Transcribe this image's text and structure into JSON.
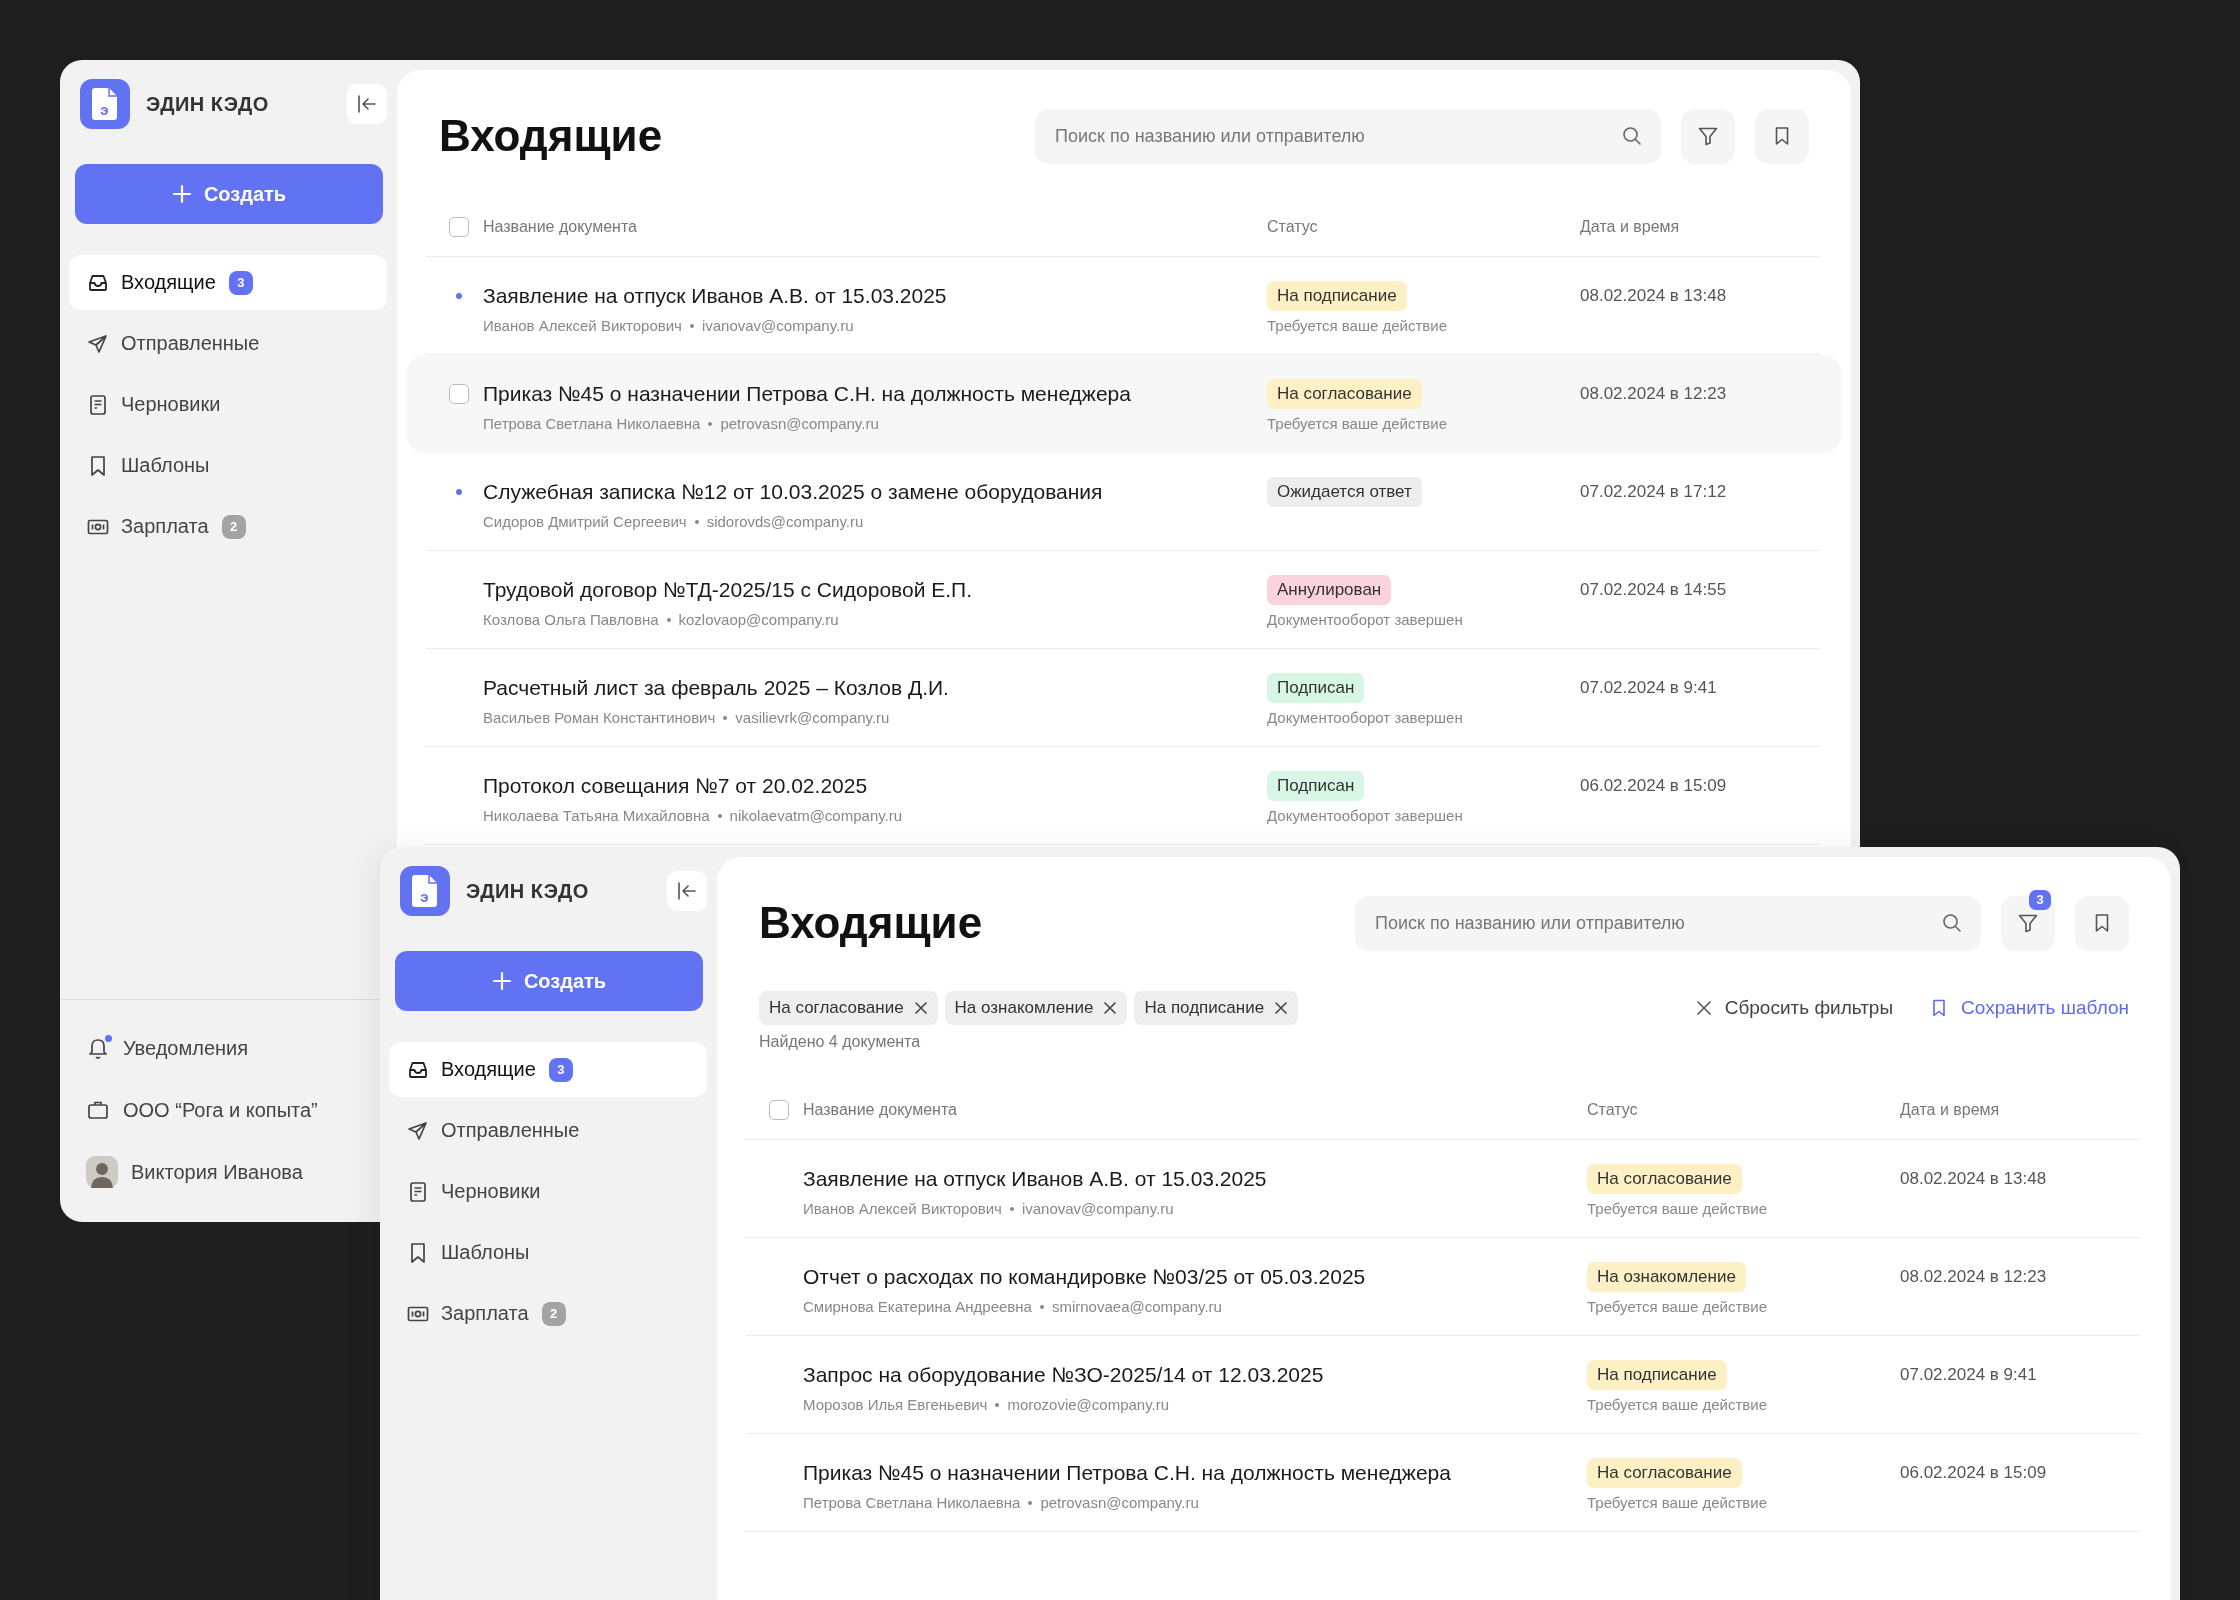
{
  "windows": [
    {
      "logo": {
        "name": "ЭДИН КЭДО",
        "letter": "э"
      },
      "create_button": "Создать",
      "nav": [
        {
          "kind": "inbox",
          "label": "Входящие",
          "badge": "3",
          "badge_accent": true,
          "selected": true
        },
        {
          "kind": "sent",
          "label": "Отправленные",
          "selected": false
        },
        {
          "kind": "drafts",
          "label": "Черновики",
          "selected": false
        },
        {
          "kind": "templates",
          "label": "Шаблоны",
          "selected": false
        },
        {
          "kind": "salary",
          "label": "Зарплата",
          "badge": "2",
          "badge_accent": false,
          "selected": false
        }
      ],
      "footer": [
        {
          "kind": "bell",
          "label": "Уведомления",
          "unread": true
        },
        {
          "kind": "company",
          "label": "ООО “Рога и копыта”"
        },
        {
          "kind": "user",
          "label": "Виктория Иванова"
        }
      ],
      "title": "Входящие",
      "search": {
        "placeholder": "Поиск по названию или отправителю"
      },
      "table": {
        "select_all": {
          "checked": false
        },
        "columns": [
          "Название документа",
          "Статус",
          "Дата и время"
        ],
        "rows": [
          {
            "title": "Заявление на отпуск Иванов А.В. от 15.03.2025",
            "sender": "Иванов Алексей Викторович",
            "email": "ivanovav@company.ru",
            "status": "На подписание",
            "color": "#fdf0c4",
            "note": "Требуется ваше действие",
            "date": "08.02.2024 в 13:48",
            "unread": true,
            "hovered": false
          },
          {
            "title": "Приказ №45 о назначении Петрова С.Н. на должность менеджера",
            "sender": "Петрова Светлана Николаевна",
            "email": "petrovasn@company.ru",
            "status": "На согласование",
            "color": "#fdf0c4",
            "note": "Требуется ваше действие",
            "date": "08.02.2024 в 12:23",
            "hovered": true
          },
          {
            "title": "Служебная записка №12 от 10.03.2025 о замене оборудования",
            "sender": "Сидоров Дмитрий Сергеевич",
            "email": "sidorovds@company.ru",
            "status": "Ожидается ответ",
            "color": "#ededed",
            "date": "07.02.2024 в 17:12",
            "unread": true,
            "hovered": false
          },
          {
            "title": "Трудовой договор №ТД-2025/15 с Сидоровой Е.П.",
            "sender": "Козлова Ольга Павловна",
            "email": "kozlovaop@company.ru",
            "status": "Аннулирован",
            "color": "#fbd3dc",
            "note": "Документооборот завершен",
            "date": "07.02.2024 в 14:55",
            "unread": false,
            "hovered": false
          },
          {
            "title": "Расчетный лист за февраль 2025 – Козлов Д.И.",
            "sender": "Васильев Роман Константинович",
            "email": "vasilievrk@company.ru",
            "status": "Подписан",
            "color": "#d7f6e4",
            "note": "Документооборот завершен",
            "date": "07.02.2024 в 9:41",
            "unread": false,
            "hovered": false
          },
          {
            "title": "Протокол совещания №7 от 20.02.2025",
            "sender": "Николаева Татьяна Михайловна",
            "email": "nikolaevatm@company.ru",
            "status": "Подписан",
            "color": "#d7f6e4",
            "note": "Документооборот завершен",
            "date": "06.02.2024 в 15:09",
            "unread": false,
            "hovered": false
          }
        ]
      }
    },
    {
      "logo": {
        "name": "ЭДИН КЭДО",
        "letter": "э"
      },
      "create_button": "Создать",
      "nav": [
        {
          "kind": "inbox",
          "label": "Входящие",
          "badge": "3",
          "badge_accent": true,
          "selected": true
        },
        {
          "kind": "sent",
          "label": "Отправленные",
          "selected": false
        },
        {
          "kind": "drafts",
          "label": "Черновики",
          "selected": false
        },
        {
          "kind": "templates",
          "label": "Шаблоны",
          "selected": false
        },
        {
          "kind": "salary",
          "label": "Зарплата",
          "badge": "2",
          "badge_accent": false,
          "selected": false
        }
      ],
      "title": "Входящие",
      "search": {
        "placeholder": "Поиск по названию или отправителю"
      },
      "filter_badge": "3",
      "filters": {
        "chips": [
          "На согласование",
          "На ознакомление",
          "На подписание"
        ],
        "reset": "Сбросить фильтры",
        "save": "Сохранить шаблон",
        "found": "Найдено 4 документа"
      },
      "table": {
        "select_all": {
          "checked": false
        },
        "columns": [
          "Название документа",
          "Статус",
          "Дата и время"
        ],
        "rows": [
          {
            "title": "Заявление на отпуск Иванов А.В. от 15.03.2025",
            "sender": "Иванов Алексей Викторович",
            "email": "ivanovav@company.ru",
            "status": "На согласование",
            "color": "#fdf0c4",
            "note": "Требуется ваше действие",
            "date": "08.02.2024 в 13:48",
            "unread": false,
            "hovered": false
          },
          {
            "title": "Отчет о расходах по командировке №03/25 от 05.03.2025",
            "sender": "Смирнова Екатерина Андреевна",
            "email": "smirnovaea@company.ru",
            "status": "На ознакомление",
            "color": "#fdf0c4",
            "note": "Требуется ваше действие",
            "date": "08.02.2024 в 12:23",
            "unread": false,
            "hovered": false
          },
          {
            "title": "Запрос на оборудование №ЗО-2025/14 от 12.03.2025",
            "sender": "Морозов Илья Евгеньевич",
            "email": "morozovie@company.ru",
            "status": "На подписание",
            "color": "#fdf0c4",
            "note": "Требуется ваше действие",
            "date": "07.02.2024 в 9:41",
            "unread": false,
            "hovered": false
          },
          {
            "title": "Приказ №45 о назначении Петрова С.Н. на должность менеджера",
            "sender": "Петрова Светлана Николаевна",
            "email": "petrovasn@company.ru",
            "status": "На согласование",
            "color": "#fdf0c4",
            "note": "Требуется ваше действие",
            "date": "06.02.2024 в 15:09",
            "unread": false,
            "hovered": false
          }
        ]
      }
    }
  ]
}
